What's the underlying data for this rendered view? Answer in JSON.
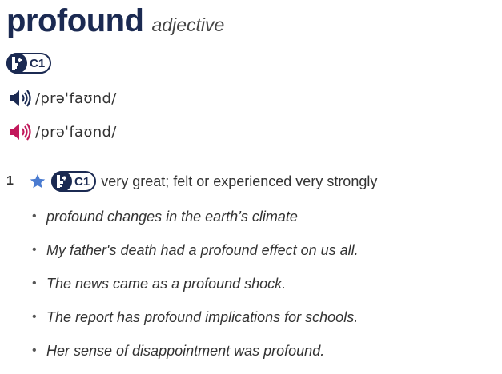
{
  "entry": {
    "headword": "profound",
    "part_of_speech": "adjective",
    "level": "C1",
    "pronunciations": [
      {
        "variant": "british",
        "ipa": "/prəˈfaʊnd/",
        "icon": "speaker-icon",
        "color": "#1b2a52"
      },
      {
        "variant": "american",
        "ipa": "/prəˈfaʊnd/",
        "icon": "speaker-icon",
        "color": "#c2185b"
      }
    ]
  },
  "sense": {
    "number": "1",
    "level": "C1",
    "definition": "very great; felt or experienced very strongly",
    "star_color": "#4a7bd0",
    "examples": [
      "profound changes in the earth’s climate",
      "My father's death had a profound effect on us all.",
      "The news came as a profound shock.",
      "The report has profound implications for schools.",
      "Her sense of disappointment was profound."
    ]
  },
  "colors": {
    "brand": "#1b2a52",
    "american": "#c2185b",
    "star": "#4a7bd0"
  }
}
